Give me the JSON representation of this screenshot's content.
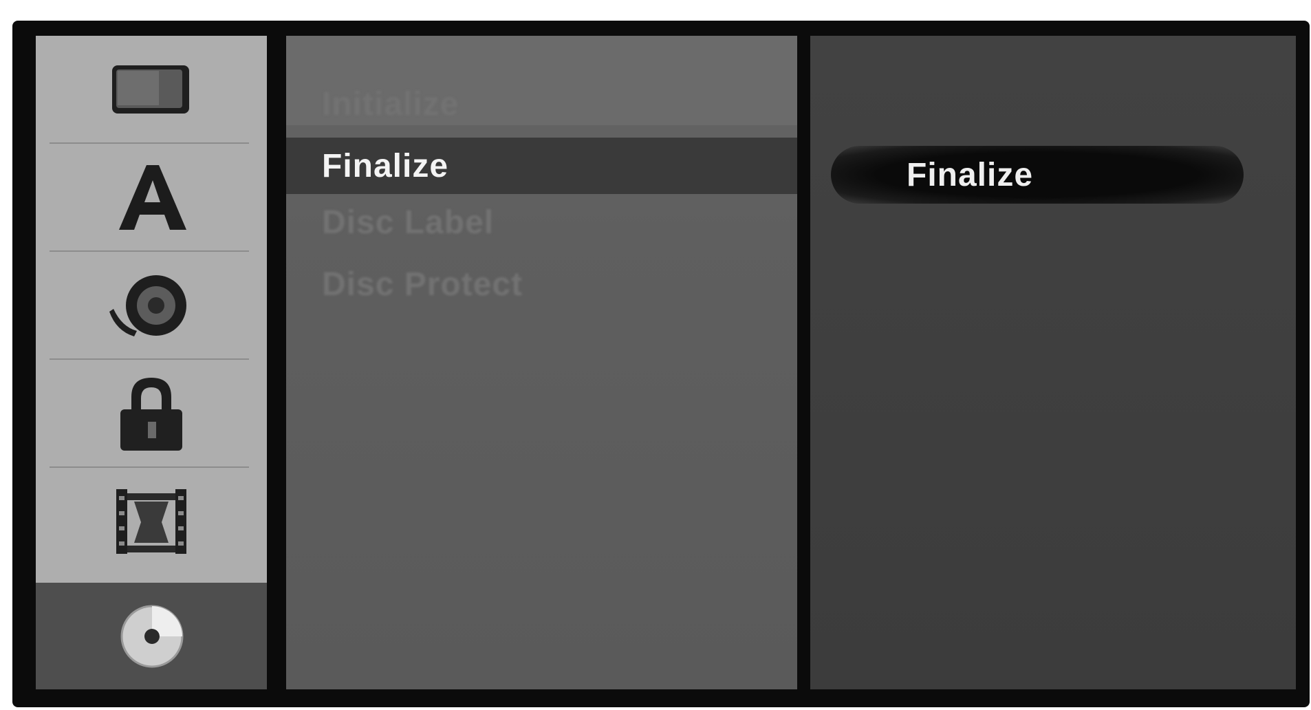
{
  "sidebar": {
    "items": [
      {
        "icon": "screen-icon",
        "selected": false
      },
      {
        "icon": "language-icon",
        "selected": false
      },
      {
        "icon": "audio-icon",
        "selected": false
      },
      {
        "icon": "lock-icon",
        "selected": false
      },
      {
        "icon": "recording-icon",
        "selected": false
      },
      {
        "icon": "disc-icon",
        "selected": true
      }
    ]
  },
  "menu": {
    "items": [
      {
        "label": "Initialize",
        "state": "dim"
      },
      {
        "label": "Finalize",
        "state": "active"
      },
      {
        "label": "Disc Label",
        "state": "dim"
      },
      {
        "label": "Disc Protect",
        "state": "dim"
      }
    ]
  },
  "options": {
    "selected_label": "Finalize"
  },
  "colors": {
    "frame": "#0b0b0b",
    "sidebar": "#aeaeae",
    "sidebar_selected": "#4e4e4e",
    "middle_panel": "#5f5f5f",
    "right_panel": "#3e3e3e",
    "highlight": "#3a3a3a",
    "text_active": "#f4f4f4"
  }
}
